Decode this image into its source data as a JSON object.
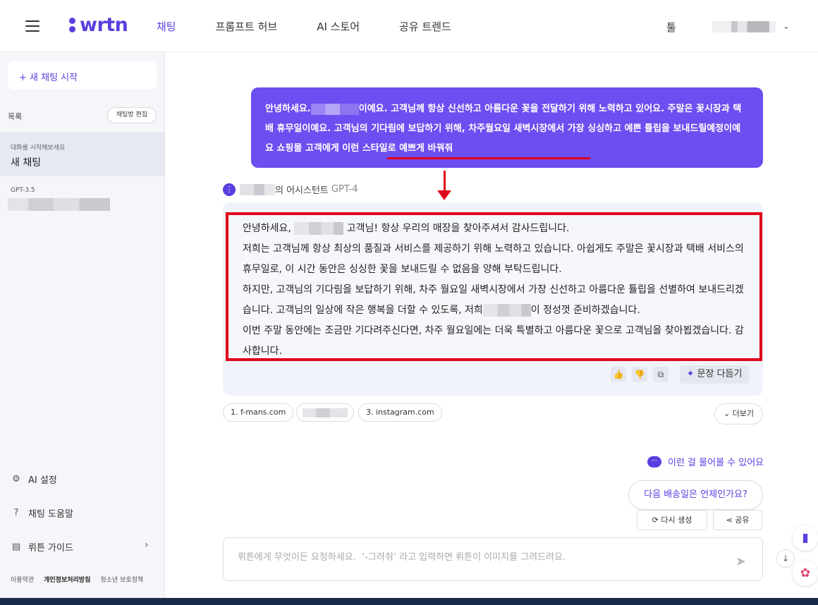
{
  "header": {
    "logo": "wrtn",
    "nav": [
      "채팅",
      "프롬프트 허브",
      "AI 스토어",
      "공유 트렌드"
    ],
    "tools": "툴"
  },
  "sidebar": {
    "new_chat": "+ 새 채팅 시작",
    "list_title": "목록",
    "edit_button": "채팅방 편집",
    "selected_chat": {
      "sub": "대화를 시작해보세요",
      "title": "새 채팅"
    },
    "second_chat_model": "GPT-3.5",
    "menu": [
      "AI 설정",
      "채팅 도움말",
      "뤼튼 가이드"
    ],
    "footer": [
      "이용약관",
      "개인정보처리방침",
      "청소년 보호정책"
    ]
  },
  "chat": {
    "user_message": {
      "part1": "안녕하세요.",
      "part2": "이예요. 고객님께 항상 신선하고 아름다운 꽃을 전달하기 위해 노력하고 있어요. 주말은 꽃시장과 택배 휴무일이예요. 고객님의 기다림에 보답하기 위해, 차주월요일 새벽시장에서 가장 싱싱하고 예쁜 튤립을 보내드릴예정이예요 ",
      "highlight": "쇼핑몰 고객에게 이런 스타일로 예쁘게 바꿔줘"
    },
    "assistant_label": "의 어시스턴트",
    "assistant_model": "GPT-4",
    "answer": {
      "l1a": "안녕하세요,",
      "l1b": "고객님! 항상 우리의 매장을 찾아주셔서 감사드립니다.",
      "l2": "저희는 고객님께 항상 최상의 품질과 서비스를 제공하기 위해 노력하고 있습니다. 아쉽게도 주말은 꽃시장과 택배 서비스의 휴무일로, 이 시간 동안은 싱싱한 꽃을 보내드릴 수 없음을 양해 부탁드립니다.",
      "l3a": "하지만, 고객님의 기다림을 보답하기 위해, 차주 월요일 새벽시장에서 가장 신선하고 아름다운 튤립을 선별하여 보내드리겠습니다. 고객님의 일상에 작은 행복을 더할 수 있도록, 저희",
      "l3b": "이 정성껏 준비하겠습니다.",
      "l4": "이번 주말 동안에는 조금만 기다려주신다면, 차주 월요일에는 더욱 특별하고 아름다운 꽃으로 고객님을 찾아뵙겠습니다. 감사합니다."
    },
    "refine_label": "문장 다듬기",
    "sources": [
      "1. f-mans.com",
      "3. instagram.com"
    ],
    "more": "더보기",
    "suggest_title": "이런 걸 물어볼 수 있어요",
    "suggestion": "다음 배송일은 언제인가요?",
    "regenerate": "다시 생성",
    "share": "공유",
    "input_placeholder": "뤼튼에게 무엇이든 요청하세요.  ‘-그려줘’ 라고 입력하면 뤼튼이 이미지를 그려드려요."
  },
  "colors": {
    "accent": "#5a3fe0",
    "bubble": "#6d4ef0",
    "annotation": "#e0001b"
  }
}
